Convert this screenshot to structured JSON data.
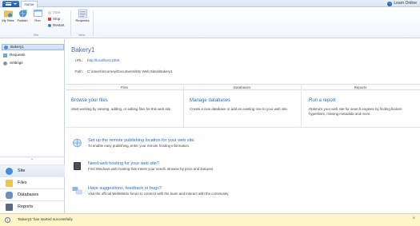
{
  "tabs": {
    "home": "Home"
  },
  "help": {
    "learn_online": "Learn Online"
  },
  "ribbon": {
    "my_sites": "My Sites",
    "publish": "Publish",
    "run": "Run",
    "start": "Start",
    "stop": "Stop",
    "restart": "Restart",
    "requests": "Requests",
    "group_site": "Site",
    "group_view": "View"
  },
  "tree": {
    "root": "Bakery1",
    "items": [
      "Requests",
      "Settings"
    ]
  },
  "workspaces": [
    "Site",
    "Files",
    "Databases",
    "Reports"
  ],
  "site": {
    "title": "Bakery1",
    "url_label": "URL:",
    "url_value": "http://localhost:1065",
    "path_label": "Path:",
    "path_value": "C:\\Users\\mcorney\\Documents\\My Web Sites\\Bakery1"
  },
  "columns": [
    {
      "header": "Files",
      "link": "Browse your files",
      "desc": "Start working by viewing, adding, or editing files for this web site."
    },
    {
      "header": "Databases",
      "link": "Manage databases",
      "desc": "Create a new database or add an existing one to your web site."
    },
    {
      "header": "Reports",
      "link": "Run a report",
      "desc": "Optimize your web site for search engines by finding broken hyperlinks, missing metadata and more."
    }
  ],
  "tips": [
    {
      "link": "Set up the remote publishing location for your web site.",
      "desc": "To enable easy publishing, enter your remote hosting information."
    },
    {
      "link": "Need web hosting for your web site?",
      "desc": "Find Windows web hosting that meets your needs. Browse by price and features."
    },
    {
      "link": "Have suggestions, feedback or bugs?",
      "desc": "Visit the official WebMatrix forum to connect with the team and interact with the community."
    }
  ],
  "status": {
    "message": "'Bakery1' has started successfully."
  },
  "colors": {
    "accent": "#2a6bbf",
    "status_bg": "#fdf6c7",
    "title": "#3a6ea5"
  }
}
